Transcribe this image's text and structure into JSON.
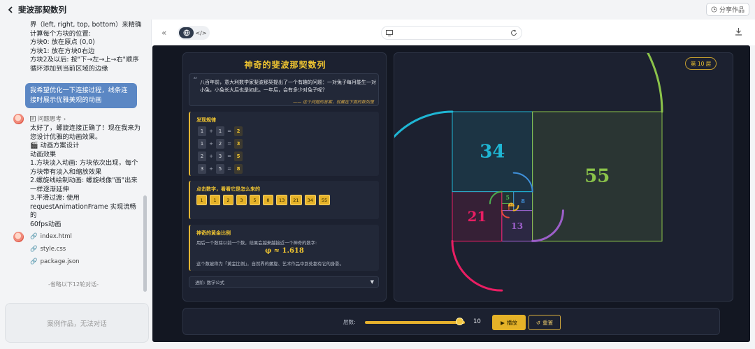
{
  "page": {
    "title": "斐波那契数列",
    "share_label": "分享作品"
  },
  "chat": {
    "intro_lines": [
      "界（left, right, top, bottom）来精确",
      "计算每个方块的位置:",
      "方块0: 放在原点 (0,0)",
      "方块1: 放在方块0右边",
      "方块2及以后: 按\"下→左→上→右\"顺序",
      "循环添加到当前区域的边缘"
    ],
    "user_message": "我希望优化一下连接过程，线条连接时展示优雅美观的动画",
    "thinking_label": "问题思考",
    "reply_lines": [
      "太好了，螺旋连接正确了！现在我来为",
      "您设计优雅的动画效果。",
      "🎬 动画方案设计",
      "动画效果",
      "1.方块淡入动画: 方块依次出现，每个",
      "方块带有淡入和缩放效果",
      "2.螺旋线绘制动画: 螺旋线像\"画\"出来",
      "一样逐渐延伸",
      "3.平滑过渡: 使用",
      "requestAnimationFrame 实现流畅的",
      "60fps动画"
    ],
    "files": [
      "index.html",
      "style.css",
      "package.json"
    ],
    "omitted_note": "-省略以下12轮对话-",
    "input_placeholder": "案例作品，无法对话"
  },
  "app": {
    "title": "神奇的斐波那契数列",
    "quote": {
      "text": "八百年前，意大利数学家斐波那契提出了一个有趣的问题：一对兔子每月能生一对小兔，小兔长大后也是如此。一年后，会有多少对兔子呢？",
      "footnote": "—— 这个问题的答案，就藏在下面的数列里"
    },
    "pattern": {
      "title": "发现规律",
      "equations": [
        [
          "1",
          "+",
          "1",
          "=",
          "2"
        ],
        [
          "1",
          "+",
          "2",
          "=",
          "3"
        ],
        [
          "2",
          "+",
          "3",
          "=",
          "5"
        ],
        [
          "3",
          "+",
          "5",
          "=",
          "8"
        ]
      ]
    },
    "click_section": {
      "title": "点击数字，看看它是怎么来的",
      "numbers": [
        "1",
        "1",
        "2",
        "3",
        "5",
        "8",
        "13",
        "21",
        "34",
        "55"
      ]
    },
    "golden": {
      "title": "神奇的黄金比例",
      "desc1": "用后一个数除以前一个数，结果会越来越接近一个神奇的数字:",
      "value": "φ ≈ 1.618",
      "desc2": "这个数被称为「黄金比例」，自然界的螺旋、艺术作品中到处都有它的身影。"
    },
    "select_label": "进阶: 数学公式",
    "layer_badge": "第 10 层",
    "controls": {
      "layers_label": "层数:",
      "slider_value": "10",
      "slider_fraction": 0.95,
      "play_label": "播放",
      "reset_label": "重置"
    }
  },
  "chart_data": {
    "type": "diagram",
    "squares": [
      {
        "label": "55",
        "side": 55,
        "color": "#8bc34a"
      },
      {
        "label": "34",
        "side": 34,
        "color": "#1fb6d4"
      },
      {
        "label": "21",
        "side": 21,
        "color": "#e91e63"
      },
      {
        "label": "13",
        "side": 13,
        "color": "#9c5fc9"
      },
      {
        "label": "8",
        "side": 8,
        "color": "#3f8fd8"
      },
      {
        "label": "5",
        "side": 5,
        "color": "#4caf50"
      },
      {
        "label": "3",
        "side": 3,
        "color": "#e64a3c"
      },
      {
        "label": "2",
        "side": 2,
        "color": "#f0b429"
      },
      {
        "label": "1",
        "side": 1,
        "color": "#f0b429"
      },
      {
        "label": "1",
        "side": 1,
        "color": "#f0b429"
      }
    ]
  },
  "icons": {
    "back": "chevron-left-icon",
    "globe": "globe-icon",
    "code": "code-icon",
    "monitor": "monitor-icon",
    "refresh": "refresh-icon",
    "download": "download-icon",
    "file": "link-icon",
    "play": "play-icon",
    "reset": "reset-icon"
  }
}
